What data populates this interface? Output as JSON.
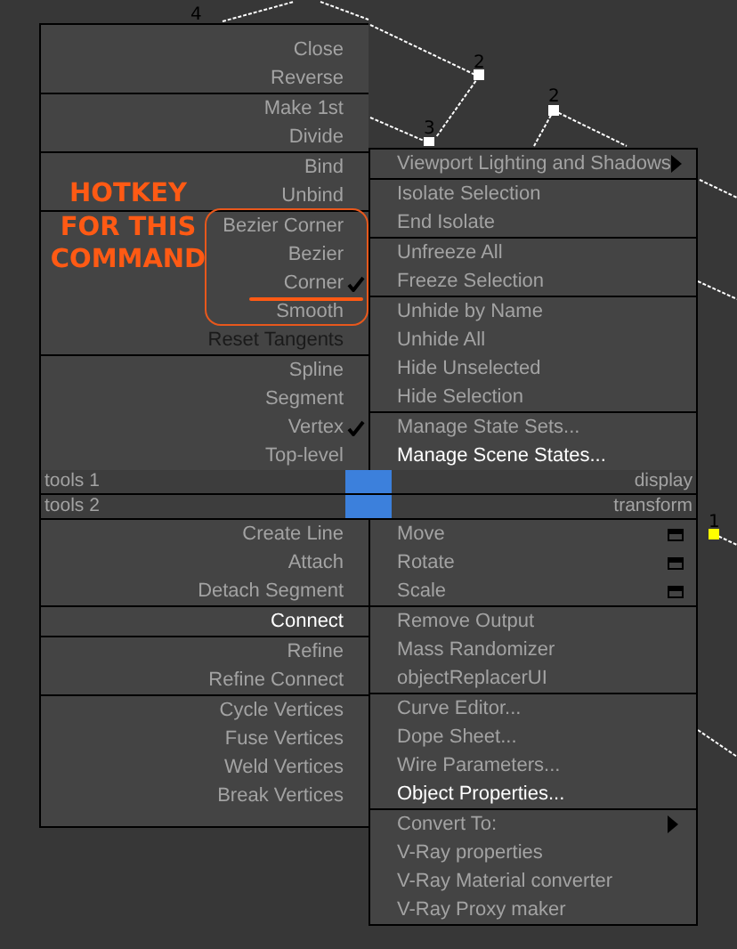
{
  "viewport": {
    "vertex_labels": [
      "4",
      "2",
      "2",
      "3",
      "1"
    ]
  },
  "quad_menu": {
    "top_left": [
      [
        {
          "label": "Close",
          "checked": false,
          "highlighted": false,
          "disabled": false
        },
        {
          "label": "Reverse",
          "checked": false,
          "highlighted": false,
          "disabled": false
        }
      ],
      [
        {
          "label": "Make 1st",
          "checked": false,
          "highlighted": false,
          "disabled": false
        },
        {
          "label": "Divide",
          "checked": false,
          "highlighted": false,
          "disabled": false
        }
      ],
      [
        {
          "label": "Bind",
          "checked": false,
          "highlighted": false,
          "disabled": false
        },
        {
          "label": "Unbind",
          "checked": false,
          "highlighted": false,
          "disabled": false
        }
      ],
      [
        {
          "label": "Bezier Corner",
          "checked": false,
          "highlighted": false,
          "disabled": false
        },
        {
          "label": "Bezier",
          "checked": false,
          "highlighted": false,
          "disabled": false
        },
        {
          "label": "Corner",
          "checked": true,
          "highlighted": false,
          "disabled": false
        },
        {
          "label": "Smooth",
          "checked": false,
          "highlighted": false,
          "disabled": false
        },
        {
          "label": "Reset Tangents",
          "checked": false,
          "highlighted": false,
          "disabled": true
        }
      ],
      [
        {
          "label": "Spline",
          "checked": false,
          "highlighted": false,
          "disabled": false
        },
        {
          "label": "Segment",
          "checked": false,
          "highlighted": false,
          "disabled": false
        },
        {
          "label": "Vertex",
          "checked": true,
          "highlighted": false,
          "disabled": false
        },
        {
          "label": "Top-level",
          "checked": false,
          "highlighted": false,
          "disabled": false
        }
      ]
    ],
    "top_right": [
      [
        {
          "label": "Viewport Lighting and Shadows",
          "highlighted": false,
          "submenu": true,
          "options": false
        }
      ],
      [
        {
          "label": "Isolate Selection",
          "highlighted": false,
          "submenu": false,
          "options": false
        },
        {
          "label": "End Isolate",
          "highlighted": false,
          "submenu": false,
          "options": false
        }
      ],
      [
        {
          "label": "Unfreeze All",
          "highlighted": false,
          "submenu": false,
          "options": false
        },
        {
          "label": "Freeze Selection",
          "highlighted": false,
          "submenu": false,
          "options": false
        }
      ],
      [
        {
          "label": "Unhide by Name",
          "highlighted": false,
          "submenu": false,
          "options": false
        },
        {
          "label": "Unhide All",
          "highlighted": false,
          "submenu": false,
          "options": false
        },
        {
          "label": "Hide Unselected",
          "highlighted": false,
          "submenu": false,
          "options": false
        },
        {
          "label": "Hide Selection",
          "highlighted": false,
          "submenu": false,
          "options": false
        }
      ],
      [
        {
          "label": "Manage State Sets...",
          "highlighted": false,
          "submenu": false,
          "options": false
        },
        {
          "label": "Manage Scene States...",
          "highlighted": true,
          "submenu": false,
          "options": false
        }
      ]
    ],
    "headers": [
      {
        "left": "tools 1",
        "right": "display"
      },
      {
        "left": "tools 2",
        "right": "transform"
      }
    ],
    "bottom_left": [
      [
        {
          "label": "Create Line",
          "checked": false,
          "highlighted": false,
          "disabled": false
        },
        {
          "label": "Attach",
          "checked": false,
          "highlighted": false,
          "disabled": false
        },
        {
          "label": "Detach Segment",
          "checked": false,
          "highlighted": false,
          "disabled": false
        }
      ],
      [
        {
          "label": "Connect",
          "checked": false,
          "highlighted": true,
          "disabled": false
        }
      ],
      [
        {
          "label": "Refine",
          "checked": false,
          "highlighted": false,
          "disabled": false
        },
        {
          "label": "Refine Connect",
          "checked": false,
          "highlighted": false,
          "disabled": false
        }
      ],
      [
        {
          "label": "Cycle Vertices",
          "checked": false,
          "highlighted": false,
          "disabled": false
        },
        {
          "label": "Fuse Vertices",
          "checked": false,
          "highlighted": false,
          "disabled": false
        },
        {
          "label": "Weld Vertices",
          "checked": false,
          "highlighted": false,
          "disabled": false
        },
        {
          "label": "Break Vertices",
          "checked": false,
          "highlighted": false,
          "disabled": false
        }
      ]
    ],
    "bottom_right": [
      [
        {
          "label": "Move",
          "highlighted": false,
          "submenu": false,
          "options": true
        },
        {
          "label": "Rotate",
          "highlighted": false,
          "submenu": false,
          "options": true
        },
        {
          "label": "Scale",
          "highlighted": false,
          "submenu": false,
          "options": true
        }
      ],
      [
        {
          "label": "Remove Output",
          "highlighted": false,
          "submenu": false,
          "options": false
        },
        {
          "label": "Mass Randomizer",
          "highlighted": false,
          "submenu": false,
          "options": false
        },
        {
          "label": "objectReplacerUI",
          "highlighted": false,
          "submenu": false,
          "options": false
        }
      ],
      [
        {
          "label": "Curve Editor...",
          "highlighted": false,
          "submenu": false,
          "options": false
        },
        {
          "label": "Dope Sheet...",
          "highlighted": false,
          "submenu": false,
          "options": false
        },
        {
          "label": "Wire Parameters...",
          "highlighted": false,
          "submenu": false,
          "options": false
        },
        {
          "label": "Object Properties...",
          "highlighted": true,
          "submenu": false,
          "options": false
        }
      ],
      [
        {
          "label": "Convert To:",
          "highlighted": false,
          "submenu": true,
          "options": false
        },
        {
          "label": "V-Ray properties",
          "highlighted": false,
          "submenu": false,
          "options": false
        },
        {
          "label": "V-Ray Material converter",
          "highlighted": false,
          "submenu": false,
          "options": false
        },
        {
          "label": "V-Ray Proxy maker",
          "highlighted": false,
          "submenu": false,
          "options": false
        }
      ]
    ]
  },
  "annotation": {
    "note": "HOTKEY FOR THIS COMMAND"
  }
}
